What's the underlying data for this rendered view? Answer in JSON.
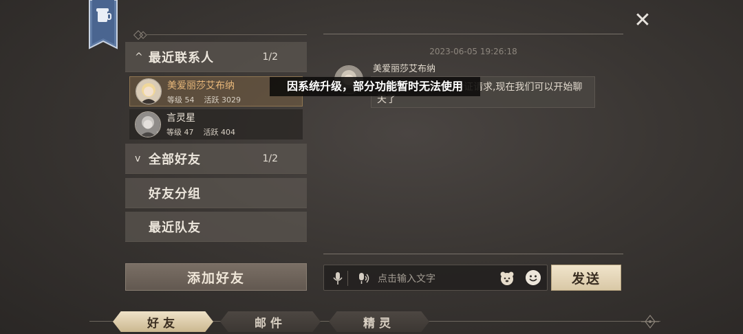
{
  "contacts": {
    "recent": {
      "label": "最近联系人",
      "count": "1/2",
      "expanded": true
    },
    "all_friends": {
      "label": "全部好友",
      "count": "1/2",
      "expanded": false
    },
    "groups_label": "好友分组",
    "recent_teammates_label": "最近队友",
    "items": [
      {
        "name": "美爱丽莎艾布纳",
        "level_label": "等级 54",
        "activity_label": "活跃 3029",
        "selected": true
      },
      {
        "name": "言灵星",
        "level_label": "等级 47",
        "activity_label": "活跃 404",
        "selected": false
      }
    ],
    "add_friend_label": "添加好友"
  },
  "chat": {
    "timestamp": "2023-06-05 19:26:18",
    "sender_name": "美爱丽莎艾布纳",
    "message": "我通过了你的好友验证请求,现在我们可以开始聊天了",
    "input_placeholder": "点击输入文字",
    "send_label": "发送"
  },
  "toast": {
    "text": "因系统升级，部分功能暂时无法使用"
  },
  "tabs": [
    {
      "label": "好友",
      "active": true
    },
    {
      "label": "邮件",
      "active": false
    },
    {
      "label": "精灵",
      "active": false
    }
  ],
  "icons": {
    "close": "close-icon",
    "banner": "banner-icon",
    "mic": "microphone-icon",
    "voice": "voice-message-icon",
    "sticker": "bear-sticker-icon",
    "emoji": "smiley-icon"
  },
  "colors": {
    "accent_gold": "#e9b87a",
    "send_button": "#e6d7b7",
    "active_tab": "#e4d5b6"
  }
}
